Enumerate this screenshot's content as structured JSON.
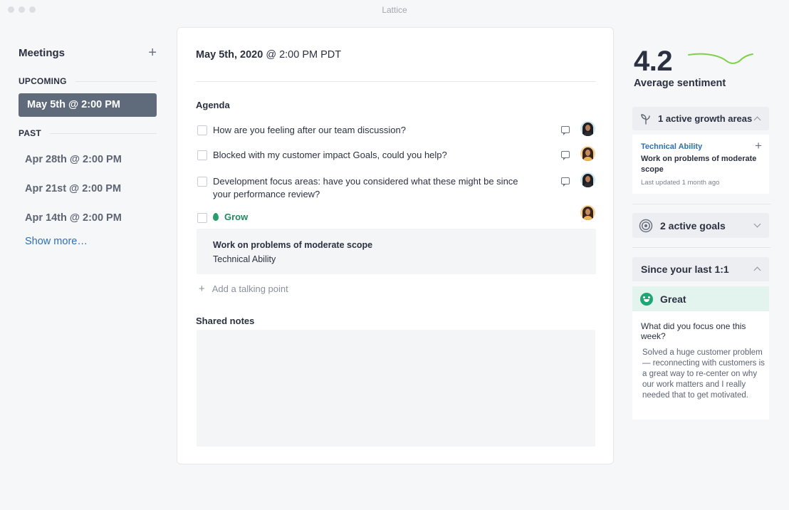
{
  "window": {
    "title": "Lattice"
  },
  "sidebar": {
    "title": "Meetings",
    "upcoming_label": "UPCOMING",
    "upcoming": [
      {
        "label": "May 5th @ 2:00 PM"
      }
    ],
    "past_label": "PAST",
    "past": [
      {
        "label": "Apr 28th @ 2:00 PM"
      },
      {
        "label": "Apr 21st @ 2:00 PM"
      },
      {
        "label": "Apr 14th @ 2:00 PM"
      }
    ],
    "show_more": "Show more…"
  },
  "meeting": {
    "date": "May 5th, 2020",
    "time": "@ 2:00 PM PDT",
    "agenda_label": "Agenda",
    "items": [
      {
        "text": "How are you feeling after our team discussion?"
      },
      {
        "text": "Blocked with my customer impact Goals, could you help?"
      },
      {
        "text": "Development focus areas: have you considered what these might be since your performance review?"
      }
    ],
    "grow": {
      "label": "Grow",
      "goal_title": "Work on problems of moderate scope",
      "goal_category": "Technical Ability"
    },
    "add_talking_point": "Add a talking point",
    "shared_notes_label": "Shared notes"
  },
  "right_panel": {
    "sentiment_value": "4.2",
    "sentiment_label": "Average sentiment",
    "growth_areas": {
      "header": "1 active growth areas",
      "category": "Technical Ability",
      "title": "Work on problems of moderate scope",
      "updated": "Last updated 1 month ago"
    },
    "goals": {
      "header": "2 active goals"
    },
    "since_last": {
      "header": "Since your last 1:1",
      "mood": "Great",
      "question": "What did you focus one this week?",
      "answer": "Solved a huge customer problem — reconnecting with customers is a great way to re-center on why our work matters and I really needed that to get motivated."
    }
  },
  "colors": {
    "active_item_bg": "#5f6b7b",
    "link": "#2f6fb3",
    "grow_green": "#1f8a5f",
    "mood_bg": "#e3f4ee",
    "sparkline": "#7fd04a"
  },
  "icons": {
    "add": "plus-icon",
    "comment": "comment-icon",
    "growth": "growth-icon",
    "goals": "target-icon",
    "mood": "smiley-icon",
    "grow": "leaf-icon",
    "collapse": "chevron-up-icon",
    "expand": "chevron-down-icon"
  }
}
